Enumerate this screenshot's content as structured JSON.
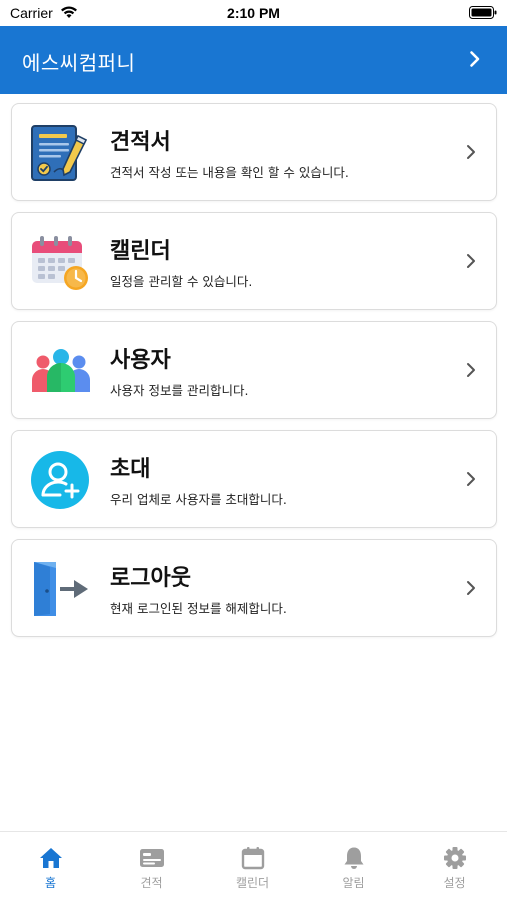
{
  "status_bar": {
    "carrier": "Carrier",
    "time": "2:10 PM"
  },
  "header": {
    "title": "에스씨컴퍼니"
  },
  "menu": {
    "items": [
      {
        "title": "견적서",
        "description": "견적서 작성 또는 내용을 확인 할 수 있습니다.",
        "icon": "quote-document-icon"
      },
      {
        "title": "캘린더",
        "description": "일정을 관리할 수 있습니다.",
        "icon": "calendar-clock-icon"
      },
      {
        "title": "사용자",
        "description": "사용자 정보를 관리합니다.",
        "icon": "users-group-icon"
      },
      {
        "title": "초대",
        "description": "우리 업체로 사용자를 초대합니다.",
        "icon": "invite-user-icon"
      },
      {
        "title": "로그아웃",
        "description": "현재 로그인된 정보를 해제합니다.",
        "icon": "logout-door-icon"
      }
    ]
  },
  "tab_bar": {
    "active": "home",
    "tabs": [
      {
        "label": "홈",
        "icon": "home-icon"
      },
      {
        "label": "견적",
        "icon": "card-icon"
      },
      {
        "label": "캘린더",
        "icon": "calendar-icon"
      },
      {
        "label": "알림",
        "icon": "bell-icon"
      },
      {
        "label": "설정",
        "icon": "gear-icon"
      }
    ]
  },
  "colors": {
    "primary": "#1976d2",
    "inactive": "#9e9e9e"
  }
}
